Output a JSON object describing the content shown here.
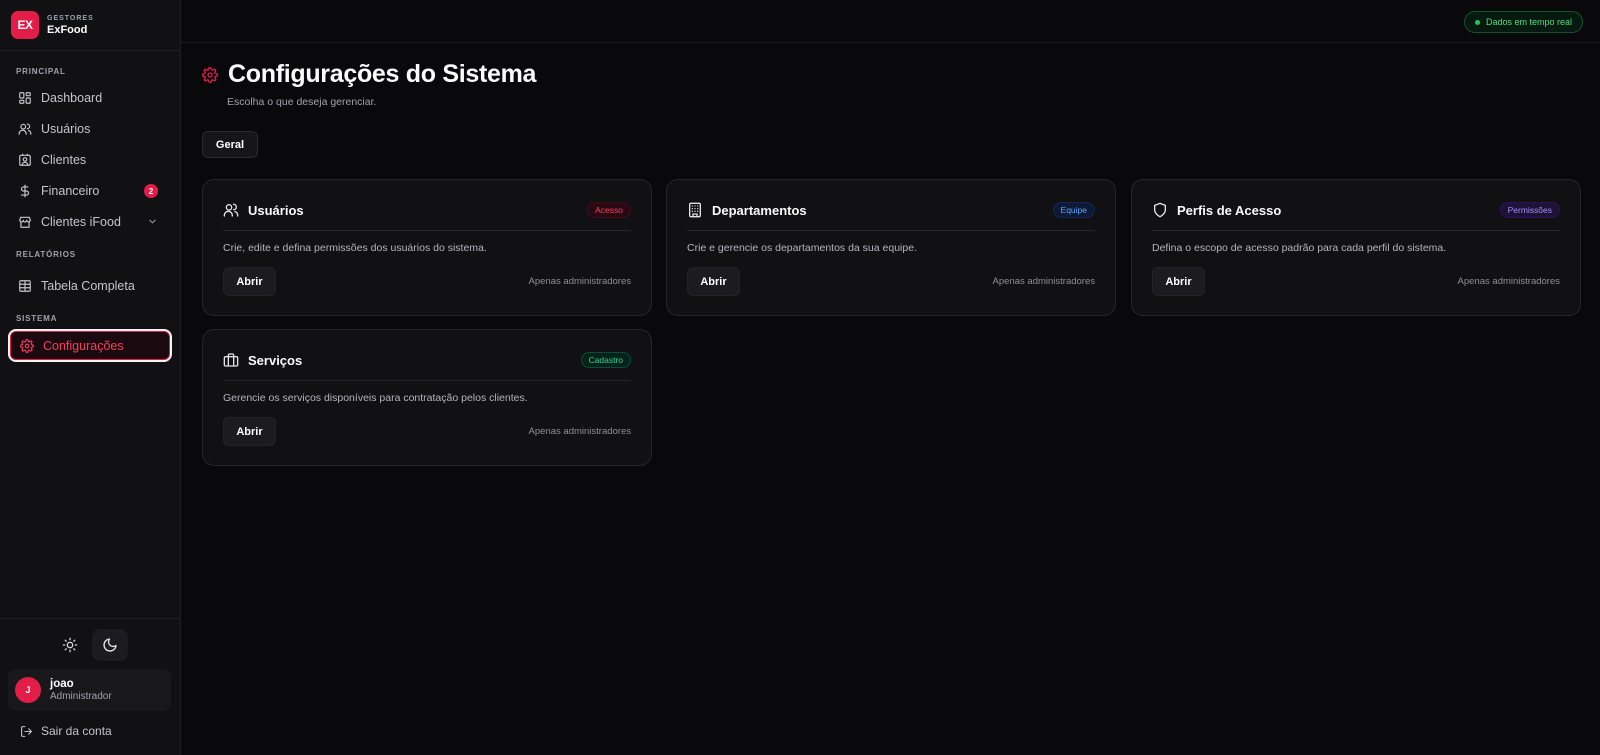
{
  "brand": {
    "logo": "EX",
    "sub": "GESTORES",
    "name": "ExFood"
  },
  "sections": {
    "principal": "PRINCIPAL",
    "relatorios": "RELATÓRIOS",
    "sistema": "SISTEMA"
  },
  "nav": {
    "dashboard": "Dashboard",
    "usuarios": "Usuários",
    "clientes": "Clientes",
    "financeiro": "Financeiro",
    "financeiro_badge": "2",
    "clientes_ifood": "Clientes iFood",
    "tabela_completa": "Tabela Completa",
    "configuracoes": "Configurações"
  },
  "user": {
    "initial": "J",
    "name": "joao",
    "role": "Administrador"
  },
  "logout_label": "Sair da conta",
  "topbar": {
    "live_label": "Dados em tempo real"
  },
  "page": {
    "title": "Configurações do Sistema",
    "subtitle": "Escolha o que deseja gerenciar.",
    "tab": "Geral"
  },
  "cards": [
    {
      "title": "Usuários",
      "tag": "Acesso",
      "desc": "Crie, edite e defina permissões dos usuários do sistema.",
      "button": "Abrir",
      "note": "Apenas administradores"
    },
    {
      "title": "Departamentos",
      "tag": "Equipe",
      "desc": "Crie e gerencie os departamentos da sua equipe.",
      "button": "Abrir",
      "note": "Apenas administradores"
    },
    {
      "title": "Perfis de Acesso",
      "tag": "Permissões",
      "desc": "Defina o escopo de acesso padrão para cada perfil do sistema.",
      "button": "Abrir",
      "note": "Apenas administradores"
    },
    {
      "title": "Serviços",
      "tag": "Cadastro",
      "desc": "Gerencie os serviços disponíveis para contratação pelos clientes.",
      "button": "Abrir",
      "note": "Apenas administradores"
    }
  ],
  "colors": {
    "accent": "#e11d48",
    "background": "#09090b",
    "sidebar": "#111113",
    "live": "#22c55e"
  },
  "icons": [
    "gear-icon",
    "dashboard-icon",
    "users-icon",
    "contact-icon",
    "dollar-icon",
    "store-icon",
    "chevron-down-icon",
    "table-icon",
    "sun-icon",
    "moon-icon",
    "logout-icon",
    "building-icon",
    "shield-icon",
    "briefcase-icon"
  ]
}
